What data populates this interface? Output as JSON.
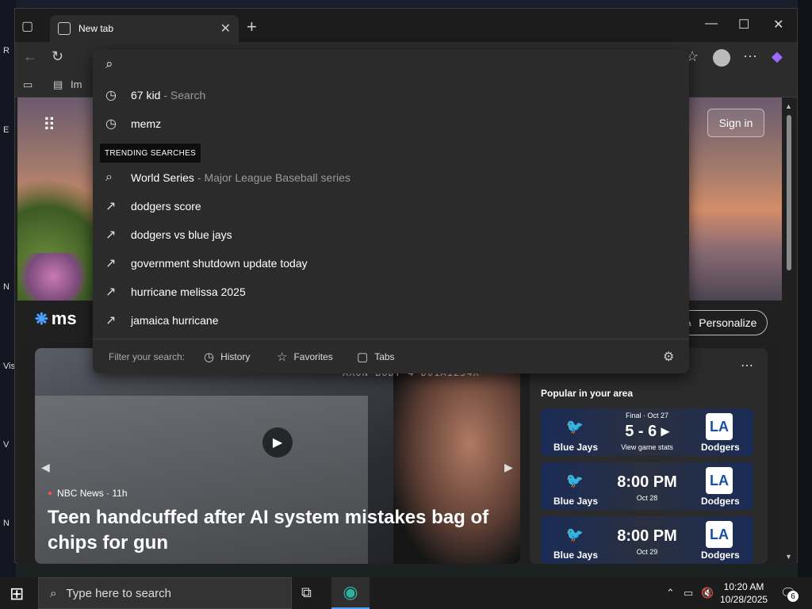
{
  "desktop": {
    "labels": [
      "R",
      "E",
      "N",
      "Vis",
      "V",
      "N"
    ]
  },
  "browser": {
    "tab": {
      "title": "New tab"
    },
    "bookmarks": {
      "first_label": "Im"
    }
  },
  "omnibox": {
    "query": "",
    "history": [
      {
        "text": "67 kid",
        "sub": "- Search"
      },
      {
        "text": "memz",
        "sub": ""
      }
    ],
    "trending_label": "TRENDING SEARCHES",
    "trending": [
      {
        "text": "World Series",
        "sub": "- Major League Baseball series",
        "icon": "search"
      },
      {
        "text": "dodgers score",
        "sub": "",
        "icon": "trend"
      },
      {
        "text": "dodgers vs blue jays",
        "sub": "",
        "icon": "trend"
      },
      {
        "text": "government shutdown update today",
        "sub": "",
        "icon": "trend"
      },
      {
        "text": "hurricane melissa 2025",
        "sub": "",
        "icon": "trend"
      },
      {
        "text": "jamaica hurricane",
        "sub": "",
        "icon": "trend"
      }
    ],
    "footer": {
      "filter_label": "Filter your search:",
      "history": "History",
      "favorites": "Favorites",
      "tabs": "Tabs"
    }
  },
  "page": {
    "sign_in": "Sign in",
    "msn_text": "ms",
    "personalize": "Personalize",
    "news": {
      "watermark": "AXON BODY 4 D01A1234X",
      "source": "NBC News · 11h",
      "title": "Teen handcuffed after AI system mistakes bag of chips for gun"
    },
    "sports": {
      "heading": "Popular in your area",
      "games": [
        {
          "home": "Blue Jays",
          "away": "Dodgers",
          "top": "Final · Oct 27",
          "main": "5 - 6 ▸",
          "sub": "View game stats"
        },
        {
          "home": "Blue Jays",
          "away": "Dodgers",
          "top": "",
          "main": "8:00 PM",
          "sub": "Oct 28"
        },
        {
          "home": "Blue Jays",
          "away": "Dodgers",
          "top": "",
          "main": "8:00 PM",
          "sub": "Oct 29"
        }
      ]
    }
  },
  "taskbar": {
    "search_placeholder": "Type here to search",
    "time": "10:20 AM",
    "date": "10/28/2025",
    "notification_count": "6"
  }
}
